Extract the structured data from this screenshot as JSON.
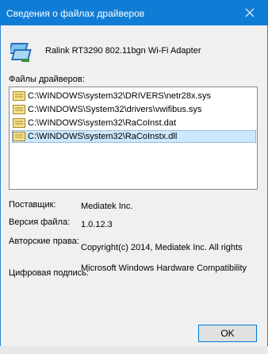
{
  "window": {
    "title": "Сведения о файлах драйверов",
    "close_icon": "close-icon",
    "accent_color": "#0f7dd6"
  },
  "device": {
    "icon": "network-adapter-icon",
    "name": "Ralink RT3290 802.11bgn Wi-Fi Adapter"
  },
  "files": {
    "label": "Файлы драйверов:",
    "items": [
      {
        "path": "C:\\WINDOWS\\system32\\DRIVERS\\netr28x.sys",
        "selected": false
      },
      {
        "path": "C:\\WINDOWS\\System32\\drivers\\vwifibus.sys",
        "selected": false
      },
      {
        "path": "C:\\WINDOWS\\system32\\RaCoInst.dat",
        "selected": false
      },
      {
        "path": "C:\\WINDOWS\\system32\\RaCoInstx.dll",
        "selected": true
      }
    ]
  },
  "info": {
    "provider_label": "Поставщик:",
    "provider_value": "Mediatek Inc.",
    "version_label": "Версия файла:",
    "version_value": "1.0.12.3",
    "copyright_label": "Авторские права:",
    "copyright_value": "Copyright(c) 2014, Mediatek Inc.  All rights",
    "signature_label": "Цифровая подпись:",
    "signature_value": "Microsoft Windows Hardware Compatibility"
  },
  "buttons": {
    "ok_label": "OK"
  }
}
